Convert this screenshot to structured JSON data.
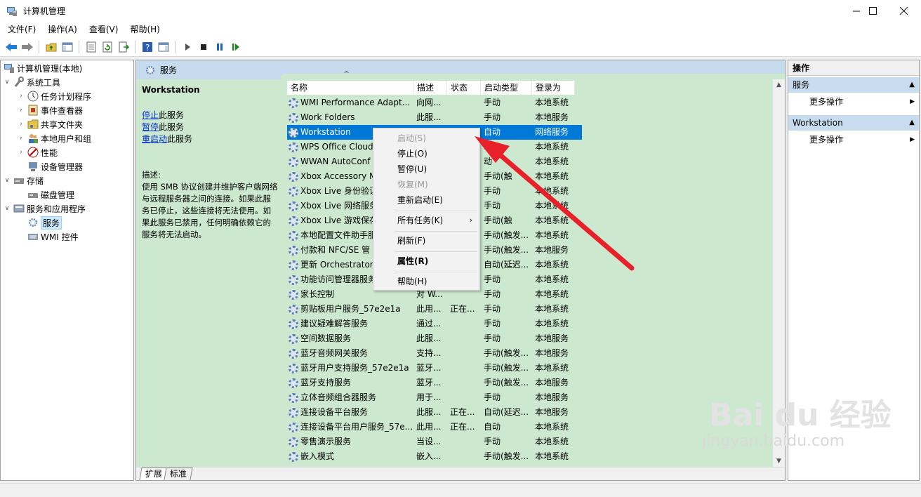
{
  "window": {
    "title": "计算机管理",
    "controls": [
      "—",
      "☐",
      "✕"
    ]
  },
  "menu": [
    "文件(F)",
    "操作(A)",
    "查看(V)",
    "帮助(H)"
  ],
  "tree": {
    "root": "计算机管理(本地)",
    "system_tools": "系统工具",
    "task_scheduler": "任务计划程序",
    "event_viewer": "事件查看器",
    "shared_folders": "共享文件夹",
    "local_users": "本地用户和组",
    "performance": "性能",
    "device_manager": "设备管理器",
    "storage": "存储",
    "disk_management": "磁盘管理",
    "services_apps": "服务和应用程序",
    "services": "服务",
    "wmi": "WMI 控件"
  },
  "main": {
    "header": "服务",
    "selected_name": "Workstation",
    "link_stop": "停止",
    "link_stop_tail": "此服务",
    "link_pause": "暂停",
    "link_pause_tail": "此服务",
    "link_restart": "重启动",
    "link_restart_tail": "此服务",
    "desc_label": "描述:",
    "desc_text": "使用 SMB 协议创建并维护客户端网络与远程服务器之间的连接。如果此服务已停止，这些连接将无法使用。如果此服务已禁用，任何明确依赖它的服务将无法启动。",
    "columns": [
      "名称",
      "描述",
      "状态",
      "启动类型",
      "登录为"
    ],
    "sort_indicator": "^",
    "rows": [
      [
        "WMI Performance Adapt...",
        "向网...",
        "",
        "手动",
        "本地系统"
      ],
      [
        "Work Folders",
        "此服...",
        "",
        "手动",
        "本地服务"
      ],
      [
        "Workstation",
        "",
        "",
        "自动",
        "网络服务"
      ],
      [
        "WPS Office Cloud",
        "",
        "",
        "动",
        "本地系统"
      ],
      [
        "WWAN AutoConf",
        "",
        "",
        "动",
        "本地系统"
      ],
      [
        "Xbox Accessory M",
        "",
        "",
        "手动(触",
        "本地系统"
      ],
      [
        "Xbox Live 身份验证",
        "",
        "",
        "手动",
        "本地系统"
      ],
      [
        "Xbox Live 网络服务",
        "",
        "",
        "手动",
        "本地系统"
      ],
      [
        "Xbox Live 游戏保存",
        "",
        "",
        "手动(触",
        "本地系统"
      ],
      [
        "本地配置文件助手服",
        "",
        "",
        "手动(触发...",
        "本地系统"
      ],
      [
        "付款和 NFC/SE 管",
        "",
        "",
        "手动(触发...",
        "本地服务"
      ],
      [
        "更新 Orchestrator",
        "",
        "",
        "自动(延迟...",
        "本地系统"
      ],
      [
        "功能访问管理器服务",
        "",
        "",
        "手动",
        "本地系统"
      ],
      [
        "家长控制",
        "对 W...",
        "",
        "手动",
        "本地系统"
      ],
      [
        "剪贴板用户服务_57e2e1a",
        "此用...",
        "正在...",
        "手动",
        "本地系统"
      ],
      [
        "建议疑难解答服务",
        "通过...",
        "",
        "手动",
        "本地系统"
      ],
      [
        "空间数据服务",
        "此服...",
        "",
        "手动",
        "本地服务"
      ],
      [
        "蓝牙音频网关服务",
        "支持...",
        "",
        "手动(触发...",
        "本地服务"
      ],
      [
        "蓝牙用户支持服务_57e2e1a",
        "蓝牙...",
        "",
        "手动(触发...",
        "本地系统"
      ],
      [
        "蓝牙支持服务",
        "蓝牙...",
        "",
        "手动(触发...",
        "本地服务"
      ],
      [
        "立体音频组合器服务",
        "用于...",
        "",
        "手动",
        "本地服务"
      ],
      [
        "连接设备平台服务",
        "此服...",
        "正在...",
        "自动(延迟...",
        "本地服务"
      ],
      [
        "连接设备平台用户服务_57e...",
        "此用...",
        "正在...",
        "自动",
        "本地系统"
      ],
      [
        "零售演示服务",
        "当设...",
        "",
        "手动",
        "本地系统"
      ],
      [
        "嵌入模式",
        "嵌入...",
        "",
        "手动(触发...",
        "本地系统"
      ]
    ],
    "tabs": [
      "扩展",
      "标准"
    ]
  },
  "context_menu": {
    "start": "启动(S)",
    "stop": "停止(O)",
    "pause": "暂停(U)",
    "resume": "恢复(M)",
    "restart": "重新启动(E)",
    "all_tasks": "所有任务(K)",
    "refresh": "刷新(F)",
    "properties": "属性(R)",
    "help": "帮助(H)"
  },
  "actions": {
    "header": "操作",
    "section1": "服务",
    "more1": "更多操作",
    "section2": "Workstation",
    "more2": "更多操作"
  },
  "watermark": {
    "brand": "Bai du 经验",
    "url": "jingyan.baidu.com"
  },
  "colors": {
    "selection": "#0078d7",
    "list_bg": "#cce8cf",
    "header_bg": "#c6dbee",
    "arrow": "#e8202a"
  }
}
